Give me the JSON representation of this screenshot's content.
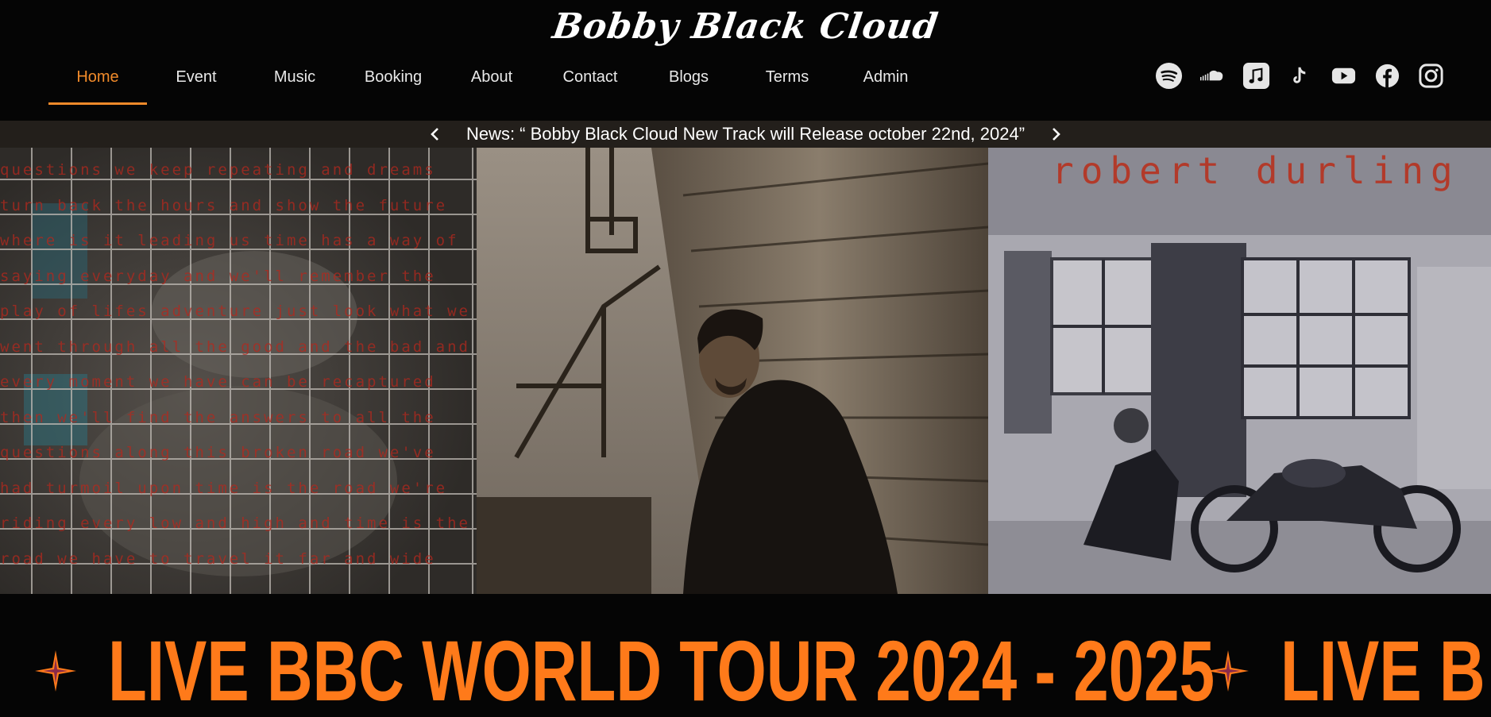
{
  "brand": {
    "title": "Bobby Black Cloud"
  },
  "nav": {
    "items": [
      {
        "label": "Home",
        "active": true
      },
      {
        "label": "Event",
        "active": false
      },
      {
        "label": "Music",
        "active": false
      },
      {
        "label": "Booking",
        "active": false
      },
      {
        "label": "About",
        "active": false
      },
      {
        "label": "Contact",
        "active": false
      },
      {
        "label": "Blogs",
        "active": false
      },
      {
        "label": "Terms",
        "active": false
      },
      {
        "label": "Admin",
        "active": false
      }
    ],
    "accent_color": "#f08a2a"
  },
  "socials": [
    {
      "name": "spotify-icon"
    },
    {
      "name": "soundcloud-icon"
    },
    {
      "name": "apple-music-icon"
    },
    {
      "name": "tiktok-icon"
    },
    {
      "name": "youtube-icon"
    },
    {
      "name": "facebook-icon"
    },
    {
      "name": "instagram-icon"
    }
  ],
  "news": {
    "text": "News: “ Bobby Black Cloud New Track will Release october 22nd, 2024”",
    "prev_icon": "chevron-left-icon",
    "next_icon": "chevron-right-icon"
  },
  "hero": {
    "panels": [
      {
        "lyrics": [
          "questions we keep repeating and dreams",
          "turn back the hours and show the future",
          "where is it leading us time has a way of",
          "saying everyday and we'll remember the",
          "play of lifes adventure just look what we",
          "went through all the good and the bad and",
          "every moment we have can be recaptured",
          "then we'll find the answers to all the",
          "questions along this broken road we've",
          "had turmoil upon time is the road we're",
          "riding every low and high and time is the",
          "road we have to travel it far and wide"
        ]
      },
      {
        "caption": ""
      },
      {
        "album_title": "robert durling"
      }
    ]
  },
  "marquee": {
    "leading_fragment": "5",
    "text": "LIVE BBC WORLD TOUR 2024 - 2025",
    "trailing_fragment": "LIVE B",
    "color": "#ff7a1a"
  }
}
